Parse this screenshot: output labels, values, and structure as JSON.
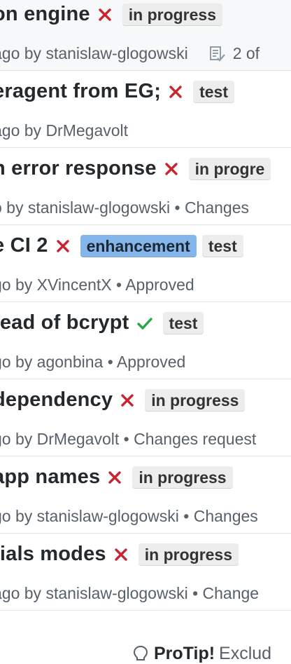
{
  "colors": {
    "fail": "#cb2431",
    "success": "#28a745",
    "enhancement_label": "#84b6eb"
  },
  "pull_requests": [
    {
      "title": "on engine",
      "status": "failure",
      "labels": [
        "in progress"
      ],
      "meta": "ago by stanislaw-glogowski",
      "tasks": "2 of"
    },
    {
      "title": "eragent from EG;",
      "status": "failure",
      "labels": [
        "test"
      ],
      "meta": "ago by DrMegavolt",
      "tasks": ""
    },
    {
      "title": "n error response",
      "status": "failure",
      "labels": [
        "in progre"
      ],
      "meta": "o by stanislaw-glogowski • Changes",
      "tasks": ""
    },
    {
      "title": "e CI 2",
      "status": "failure",
      "labels": [
        "enhancement",
        "test"
      ],
      "meta": "go by XVincentX • Approved",
      "tasks": ""
    },
    {
      "title": "tead of bcrypt",
      "status": "success",
      "labels": [
        "test"
      ],
      "meta": "go by agonbina • Approved",
      "tasks": ""
    },
    {
      "title": "dependency",
      "status": "failure",
      "labels": [
        "in progress"
      ],
      "meta": "go by DrMegavolt • Changes request",
      "tasks": ""
    },
    {
      "title": "app names",
      "status": "failure",
      "labels": [
        "in progress"
      ],
      "meta": "go by stanislaw-glogowski • Changes",
      "tasks": ""
    },
    {
      "title": "tials modes",
      "status": "failure",
      "labels": [
        "in progress"
      ],
      "meta": "ago by stanislaw-glogowski • Change",
      "tasks": ""
    }
  ],
  "protip": {
    "icon": "lightbulb-icon",
    "bold": "ProTip!",
    "text": "Exclud"
  }
}
